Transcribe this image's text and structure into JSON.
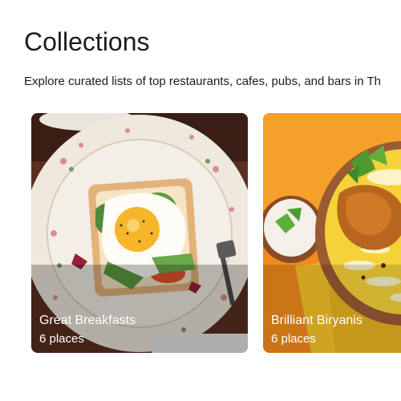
{
  "header": {
    "title": "Collections",
    "subtitle": "Explore curated lists of top restaurants, cafes, pubs, and bars in Th"
  },
  "collections": [
    {
      "name": "Great Breakfasts",
      "count": "6 places",
      "image": "fried-egg-toast-on-floral-plate"
    },
    {
      "name": "Brilliant Biryanis",
      "count": "6 places",
      "image": "chicken-biryani-with-raita"
    }
  ]
}
